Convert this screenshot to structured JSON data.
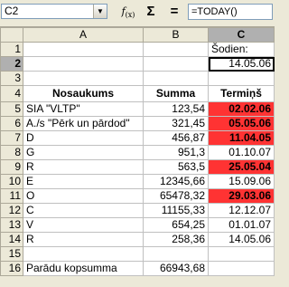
{
  "formula_bar": {
    "name_box": "C2",
    "function_wizard": "f(x)",
    "sum": "Σ",
    "equals": "=",
    "formula": "=TODAY()"
  },
  "columns": [
    "A",
    "B",
    "C"
  ],
  "rows": [
    {
      "n": "1",
      "a": "",
      "b": "",
      "c": "Šodien:"
    },
    {
      "n": "2",
      "a": "",
      "b": "",
      "c": "14.05.06"
    },
    {
      "n": "3",
      "a": "",
      "b": "",
      "c": ""
    },
    {
      "n": "4",
      "a": "Nosaukums",
      "b": "Summa",
      "c": "Termiņš"
    },
    {
      "n": "5",
      "a": "SIA \"VLTP\"",
      "b": "123,54",
      "c": "02.02.06"
    },
    {
      "n": "6",
      "a": "A./s \"Pērk un pārdod\"",
      "b": "321,45",
      "c": "05.05.06"
    },
    {
      "n": "7",
      "a": "D",
      "b": "456,87",
      "c": "11.04.05"
    },
    {
      "n": "8",
      "a": "G",
      "b": "951,3",
      "c": "01.10.07"
    },
    {
      "n": "9",
      "a": "R",
      "b": "563,5",
      "c": "25.05.04"
    },
    {
      "n": "10",
      "a": "E",
      "b": "12345,66",
      "c": "15.09.06"
    },
    {
      "n": "11",
      "a": "O",
      "b": "65478,32",
      "c": "29.03.06"
    },
    {
      "n": "12",
      "a": "C",
      "b": "11155,33",
      "c": "12.12.07"
    },
    {
      "n": "13",
      "a": "V",
      "b": "654,25",
      "c": "01.01.07"
    },
    {
      "n": "14",
      "a": "R",
      "b": "258,36",
      "c": "14.05.06"
    },
    {
      "n": "15",
      "a": "",
      "b": "",
      "c": ""
    },
    {
      "n": "16",
      "a": "Parādu kopsumma",
      "b": "66943,68",
      "c": ""
    }
  ],
  "colors": {
    "overdue_fill": "#ff3333",
    "header_bg": "#ece9d8"
  }
}
